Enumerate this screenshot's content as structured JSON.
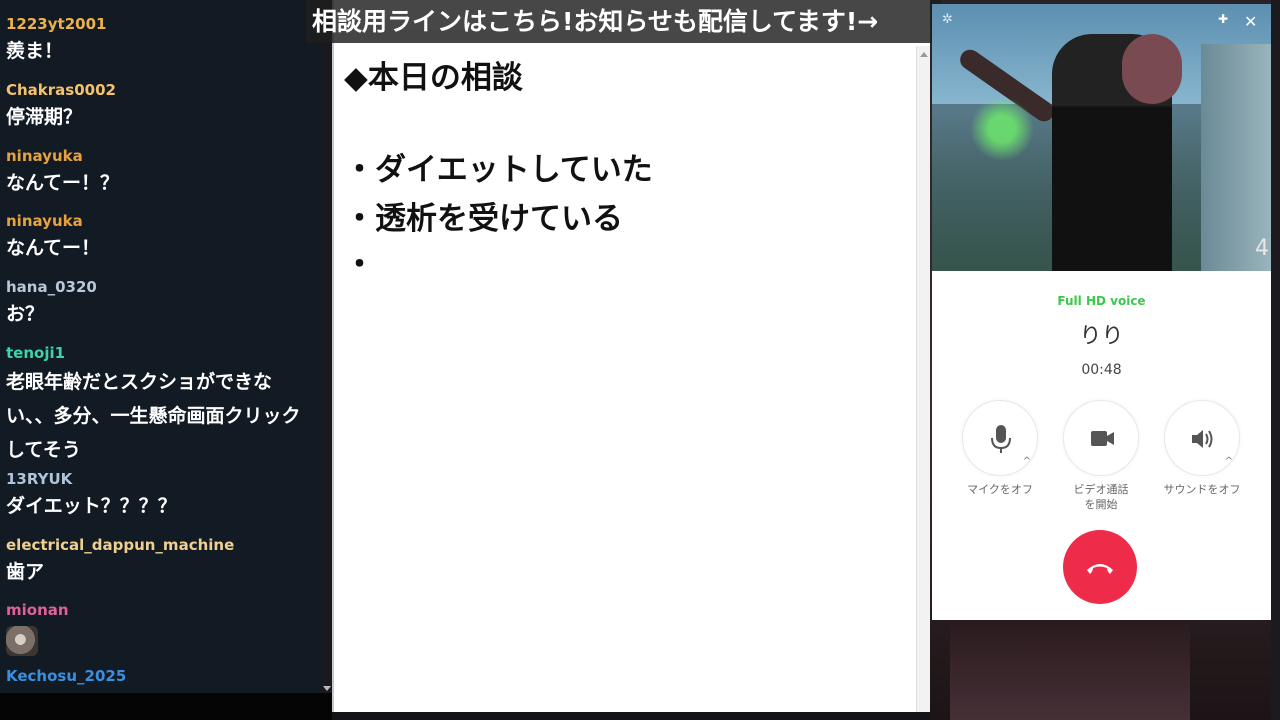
{
  "announcement": {
    "text": "相談用ラインはこちら!お知らせも配信してます!→"
  },
  "chat": {
    "messages": [
      {
        "user": "1223yt2001",
        "text": "羨ま！",
        "color": "#f0b14a"
      },
      {
        "user": "Chakras0002",
        "text": "停滞期？",
        "color": "#f5c26b"
      },
      {
        "user": "ninayuka",
        "text": "なんてー！？",
        "color": "#e8a23c"
      },
      {
        "user": "ninayuka",
        "text": "なんてー！",
        "color": "#e8a23c"
      },
      {
        "user": "hana_0320",
        "text": "お？",
        "color": "#b8c8d8"
      },
      {
        "user": "tenoji1",
        "text": "老眼年齢だとスクショができない、、多分、一生懸命画面クリックしてそう",
        "color": "#3fd3a6"
      },
      {
        "user": "13RYUK",
        "text": "ダイエット？？？？",
        "color": "#b0c4d8"
      },
      {
        "user": "electrical_dappun_machine",
        "text": "歯ア",
        "color": "#f0d090"
      },
      {
        "user": "mionan",
        "text": "",
        "color": "#e0609a",
        "emote": "hamster-emote"
      },
      {
        "user": "Kechosu_2025",
        "text": "",
        "color": "#3b8fe0"
      }
    ]
  },
  "notepad": {
    "title": "◆本日の相談",
    "bullets": [
      "・ダイエットしていた",
      "・透析を受けている",
      "・"
    ]
  },
  "call": {
    "status": "Full HD voice",
    "caller": "りり",
    "timer": "00:48",
    "video_badge": "4",
    "controls": [
      {
        "label": "マイクをオフ",
        "icon": "microphone-icon"
      },
      {
        "label": "ビデオ通話を開始",
        "icon": "video-camera-icon"
      },
      {
        "label": "サウンドをオフ",
        "icon": "speaker-icon"
      }
    ],
    "hangup_icon": "phone-hangup-icon",
    "pin_icon": "pin-icon",
    "close_icon": "close-icon",
    "gear_icon": "gear-icon",
    "hangup_color": "#ef2b4a",
    "status_color": "#3cc84a"
  }
}
